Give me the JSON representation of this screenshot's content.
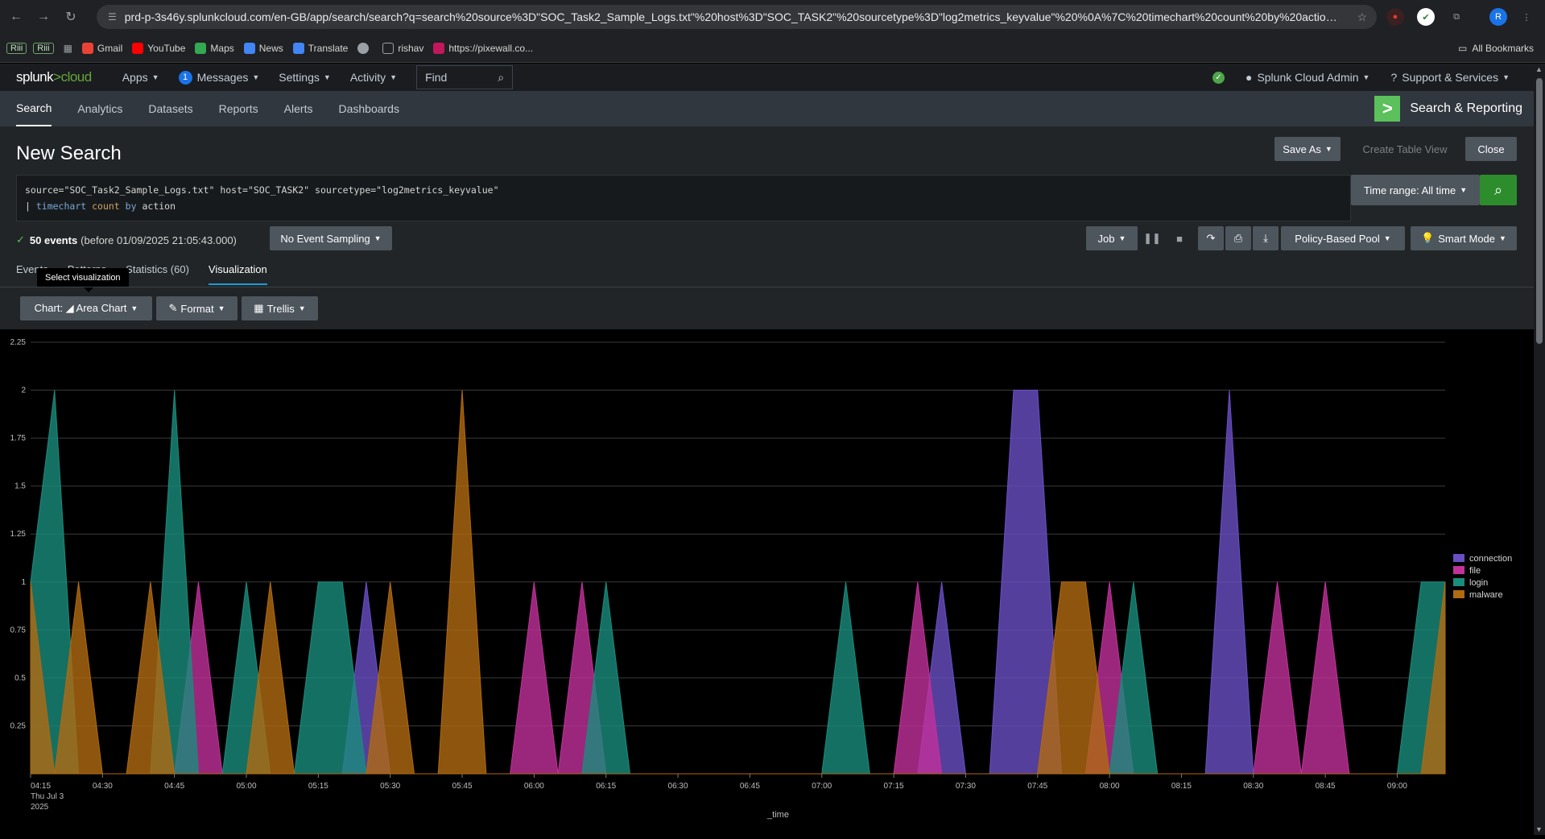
{
  "browser": {
    "url": "prd-p-3s46y.splunkcloud.com/en-GB/app/search/search?q=search%20source%3D\"SOC_Task2_Sample_Logs.txt\"%20host%3D\"SOC_TASK2\"%20sourcetype%3D\"log2metrics_keyvalue\"%20%0A%7C%20timechart%20count%20by%20action&earlies...",
    "profile_initial": "R",
    "bookmarks": [
      {
        "label": "Gmail",
        "color": "#ea4335"
      },
      {
        "label": "YouTube",
        "color": "#ff0000"
      },
      {
        "label": "Maps",
        "color": "#34a853"
      },
      {
        "label": "News",
        "color": "#4285f4"
      },
      {
        "label": "Translate",
        "color": "#4285f4"
      },
      {
        "label": "",
        "color": "#9aa0a6"
      },
      {
        "label": "rishav",
        "color": "#9aa0a6"
      },
      {
        "label": "https://pixewall.co...",
        "color": "#c2185b"
      }
    ],
    "bookmark_pills": [
      "Riii",
      "Riii"
    ],
    "all_bookmarks": "All Bookmarks"
  },
  "splunk_bar": {
    "logo_main": "splunk",
    "logo_gt": ">",
    "logo_cloud": "cloud",
    "apps": "Apps",
    "messages_count": "1",
    "messages": "Messages",
    "settings": "Settings",
    "activity": "Activity",
    "find": "Find",
    "user": "Splunk Cloud Admin",
    "support": "Support & Services"
  },
  "app_bar": {
    "tabs": [
      "Search",
      "Analytics",
      "Datasets",
      "Reports",
      "Alerts",
      "Dashboards"
    ],
    "app_title": "Search & Reporting"
  },
  "page": {
    "title": "New Search",
    "save_as": "Save As",
    "create_table_view": "Create Table View",
    "close": "Close",
    "query_line1_a": "source=\"SOC_Task2_Sample_Logs.txt\" host=\"SOC_TASK2\" sourcetype=\"log2metrics_keyvalue\"",
    "query_line2_pipe": "| ",
    "query_line2_cmd": "timechart",
    "query_line2_fn": "count",
    "query_line2_by": "by",
    "query_line2_field": "action",
    "time_range": "Time range: All time",
    "events_count": "50 events",
    "events_note": "(before 01/09/2025 21:05:43.000)",
    "sampling": "No Event Sampling",
    "job": "Job",
    "pool": "Policy-Based Pool",
    "mode": "Smart Mode",
    "tabs": [
      "Events",
      "Patterns",
      "Statistics (60)",
      "Visualization"
    ],
    "tooltip": "Select visualization",
    "chart_btn": "Chart: ◢ Area Chart",
    "format_btn": "Format",
    "trellis_btn": "Trellis"
  },
  "colors": {
    "connection": "#6a4fc4",
    "file": "#c2319b",
    "login": "#1a8c7d",
    "malware": "#b06a10"
  },
  "chart_data": {
    "type": "area",
    "x": [
      "04:15",
      "04:20",
      "04:25",
      "04:30",
      "04:35",
      "04:40",
      "04:45",
      "04:50",
      "04:55",
      "05:00",
      "05:05",
      "05:10",
      "05:15",
      "05:20",
      "05:25",
      "05:30",
      "05:35",
      "05:40",
      "05:45",
      "05:50",
      "05:55",
      "06:00",
      "06:05",
      "06:10",
      "06:15",
      "06:20",
      "06:25",
      "06:30",
      "06:35",
      "06:40",
      "06:45",
      "06:50",
      "06:55",
      "07:00",
      "07:05",
      "07:10",
      "07:15",
      "07:20",
      "07:25",
      "07:30",
      "07:35",
      "07:40",
      "07:45",
      "07:50",
      "07:55",
      "08:00",
      "08:05",
      "08:10",
      "08:15",
      "08:20",
      "08:25",
      "08:30",
      "08:35",
      "08:40",
      "08:45",
      "08:50",
      "08:55",
      "09:00",
      "09:05",
      "09:10"
    ],
    "x_tick_labels": [
      "04:15",
      "04:30",
      "04:45",
      "05:00",
      "05:15",
      "05:30",
      "05:45",
      "06:00",
      "06:15",
      "06:30",
      "06:45",
      "07:00",
      "07:15",
      "07:30",
      "07:45",
      "08:00",
      "08:15",
      "08:30",
      "08:45",
      "09:00"
    ],
    "x_first_sub": [
      "Thu Jul 3",
      "2025"
    ],
    "xlabel": "_time",
    "ylabel": "",
    "ylim": [
      0,
      2.25
    ],
    "y_ticks": [
      "0.25",
      "0.5",
      "0.75",
      "1",
      "1.25",
      "1.5",
      "1.75",
      "2",
      "2.25"
    ],
    "legend_position": "right",
    "series": [
      {
        "name": "connection",
        "values": [
          0,
          0,
          0,
          0,
          0,
          0,
          0,
          0,
          0,
          0,
          0,
          0,
          0,
          0,
          1,
          0,
          0,
          0,
          0,
          0,
          0,
          0,
          0,
          0,
          0,
          0,
          0,
          0,
          0,
          0,
          0,
          0,
          0,
          0,
          0,
          0,
          0,
          0,
          1,
          0,
          0,
          2,
          2,
          0,
          0,
          0,
          0,
          0,
          0,
          0,
          2,
          0,
          0,
          0,
          0,
          0,
          0,
          0,
          0,
          0
        ]
      },
      {
        "name": "file",
        "values": [
          0,
          0,
          0,
          0,
          0,
          0,
          0,
          1,
          0,
          0,
          0,
          0,
          0,
          0,
          0,
          0,
          0,
          0,
          0,
          0,
          0,
          1,
          0,
          1,
          0,
          0,
          0,
          0,
          0,
          0,
          0,
          0,
          0,
          0,
          0,
          0,
          0,
          1,
          0,
          0,
          0,
          0,
          0,
          0,
          0,
          1,
          0,
          0,
          0,
          0,
          0,
          0,
          1,
          0,
          1,
          0,
          0,
          0,
          0,
          0
        ]
      },
      {
        "name": "login",
        "values": [
          1,
          2,
          0,
          0,
          0,
          0,
          2,
          0,
          0,
          1,
          0,
          0,
          1,
          1,
          0,
          0,
          0,
          0,
          0,
          0,
          0,
          0,
          0,
          0,
          1,
          0,
          0,
          0,
          0,
          0,
          0,
          0,
          0,
          0,
          1,
          0,
          0,
          0,
          0,
          0,
          0,
          0,
          0,
          0,
          0,
          0,
          1,
          0,
          0,
          0,
          0,
          0,
          0,
          0,
          0,
          0,
          0,
          0,
          1,
          1
        ]
      },
      {
        "name": "malware",
        "values": [
          1,
          0,
          1,
          0,
          0,
          1,
          0,
          0,
          0,
          0,
          1,
          0,
          0,
          0,
          0,
          1,
          0,
          0,
          2,
          0,
          0,
          0,
          0,
          0,
          0,
          0,
          0,
          0,
          0,
          0,
          0,
          0,
          0,
          0,
          0,
          0,
          0,
          0,
          0,
          0,
          0,
          0,
          0,
          1,
          1,
          0,
          0,
          0,
          0,
          0,
          0,
          0,
          0,
          0,
          0,
          0,
          0,
          0,
          0,
          1
        ]
      }
    ]
  }
}
